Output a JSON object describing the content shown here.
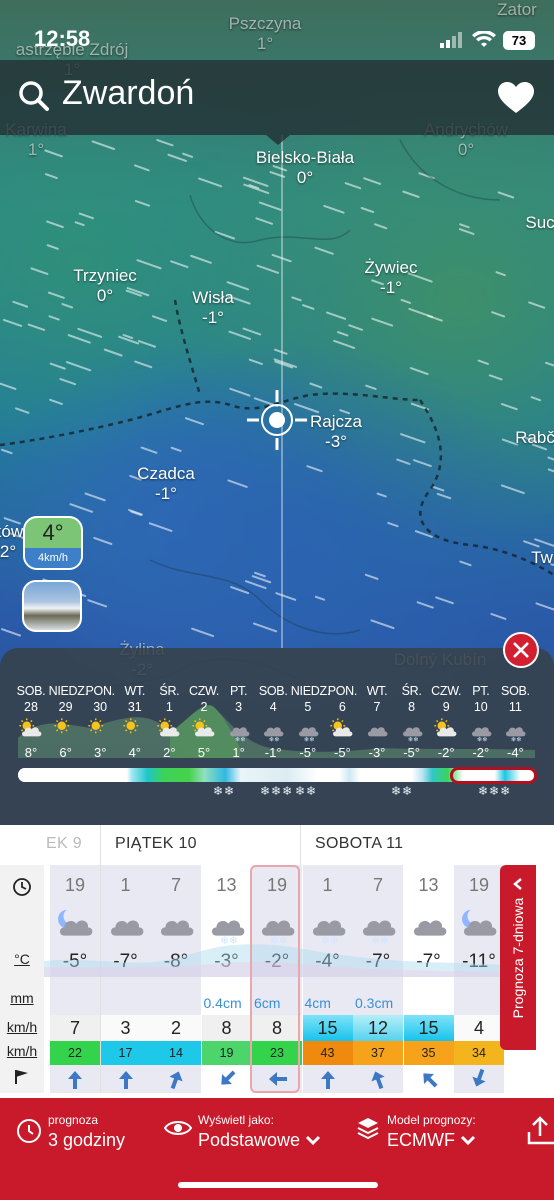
{
  "status": {
    "time": "12:58",
    "battery": "73"
  },
  "header": {
    "location": "Zwardoń"
  },
  "map": {
    "labels": [
      {
        "name": "Pszczyna",
        "temp": "1°",
        "dim": true
      },
      {
        "name": "Zator",
        "temp": "",
        "dim": true
      },
      {
        "name": "astrzębie Zdrój",
        "temp": "1°",
        "dim": true
      },
      {
        "name": "Karwina",
        "temp": "1°",
        "dim": true
      },
      {
        "name": "Andrychów",
        "temp": "0°",
        "dim": true
      },
      {
        "name": "Bielsko-Biała",
        "temp": "0°",
        "dim": false
      },
      {
        "name": "Suc",
        "temp": "",
        "dim": false
      },
      {
        "name": "Trzyniec",
        "temp": "0°",
        "dim": false
      },
      {
        "name": "Wisła",
        "temp": "-1°",
        "dim": false
      },
      {
        "name": "Żywiec",
        "temp": "-1°",
        "dim": false
      },
      {
        "name": "Rajcza",
        "temp": "-3°",
        "dim": false
      },
      {
        "name": "Rabč",
        "temp": "",
        "dim": false
      },
      {
        "name": "Czadca",
        "temp": "-1°",
        "dim": false
      },
      {
        "name": "ków",
        "temp": "2°",
        "dim": false
      },
      {
        "name": "Tw",
        "temp": "",
        "dim": false
      },
      {
        "name": "Żylina",
        "temp": "-2°",
        "dim": true
      },
      {
        "name": "Dolný Kubín",
        "temp": "",
        "dim": true
      }
    ],
    "badge": {
      "temp": "4°",
      "wind": "4km/h"
    }
  },
  "strip": {
    "days": [
      {
        "name": "SOB.",
        "date": "28",
        "icon": "sun-cloud",
        "temp": "8°"
      },
      {
        "name": "NIEDZ.",
        "date": "29",
        "icon": "sun",
        "temp": "6°"
      },
      {
        "name": "PON.",
        "date": "30",
        "icon": "sun",
        "temp": "3°"
      },
      {
        "name": "WT.",
        "date": "31",
        "icon": "sun",
        "temp": "4°"
      },
      {
        "name": "ŚR.",
        "date": "1",
        "icon": "sun-cloud",
        "temp": "2°"
      },
      {
        "name": "CZW.",
        "date": "2",
        "icon": "sun-cloud",
        "temp": "5°"
      },
      {
        "name": "PT.",
        "date": "3",
        "icon": "snow-cloud",
        "temp": "1°"
      },
      {
        "name": "SOB.",
        "date": "4",
        "icon": "snow-cloud",
        "temp": "-1°"
      },
      {
        "name": "NIEDZ.",
        "date": "5",
        "icon": "snow-cloud",
        "temp": "-5°"
      },
      {
        "name": "PON.",
        "date": "6",
        "icon": "sun-cloud",
        "temp": "-5°"
      },
      {
        "name": "WT.",
        "date": "7",
        "icon": "cloud",
        "temp": "-3°"
      },
      {
        "name": "ŚR.",
        "date": "8",
        "icon": "snow-cloud",
        "temp": "-5°"
      },
      {
        "name": "CZW.",
        "date": "9",
        "icon": "sun-cloud",
        "temp": "-2°"
      },
      {
        "name": "PT.",
        "date": "10",
        "icon": "snow-cloud",
        "temp": "-2°"
      },
      {
        "name": "SOB.",
        "date": "11",
        "icon": "snow-cloud",
        "temp": "-4°"
      }
    ],
    "snow_marks": [
      "❄❄",
      "❄❄❄",
      "❄❄",
      "❄❄",
      "❄❄❄"
    ]
  },
  "table": {
    "day_headers": [
      "EK 9",
      "PIĄTEK 10",
      "SOBOTA 11"
    ],
    "row_labels": {
      "temp": "°C",
      "precip": "mm",
      "wind": "km/h",
      "gust": "km/h"
    },
    "columns": [
      {
        "hour": "19",
        "icon": "moon-cloud",
        "temp": "-5°",
        "precip": "",
        "wind": "7",
        "gust": "22",
        "dir": 180,
        "shade": true
      },
      {
        "hour": "1",
        "icon": "cloud",
        "temp": "-7°",
        "precip": "",
        "wind": "3",
        "gust": "17",
        "dir": 180,
        "shade": true
      },
      {
        "hour": "7",
        "icon": "cloud",
        "temp": "-8°",
        "precip": "",
        "wind": "2",
        "gust": "14",
        "dir": 200,
        "shade": true
      },
      {
        "hour": "13",
        "icon": "snow-cloud",
        "temp": "-3°",
        "precip": "0.4cm",
        "wind": "8",
        "gust": "19",
        "dir": 45,
        "shade": false
      },
      {
        "hour": "19",
        "icon": "snow-cloud",
        "temp": "-2°",
        "precip": "6cm",
        "wind": "8",
        "gust": "23",
        "dir": 90,
        "shade": true
      },
      {
        "hour": "1",
        "icon": "snow-cloud",
        "temp": "-4°",
        "precip": "4cm",
        "wind": "15",
        "gust": "43",
        "dir": 180,
        "shade": true
      },
      {
        "hour": "7",
        "icon": "snow-cloud",
        "temp": "-7°",
        "precip": "0.3cm",
        "wind": "12",
        "gust": "37",
        "dir": 160,
        "shade": true
      },
      {
        "hour": "13",
        "icon": "cloud",
        "temp": "-7°",
        "precip": "",
        "wind": "15",
        "gust": "35",
        "dir": 135,
        "shade": false
      },
      {
        "hour": "19",
        "icon": "moon-cloud",
        "temp": "-11°",
        "precip": "",
        "wind": "4",
        "gust": "34",
        "dir": 20,
        "shade": true
      }
    ],
    "side_tab": "Prognoza 7-dniowa"
  },
  "bottom": {
    "interval": {
      "label": "prognoza",
      "value": "3 godziny"
    },
    "display": {
      "label": "Wyświetl jako:",
      "value": "Podstawowe"
    },
    "model": {
      "label": "Model prognozy:",
      "value": "ECMWF"
    }
  },
  "colors": {
    "accent": "#c81a2a",
    "precip_blue": "#3a8fd6"
  }
}
